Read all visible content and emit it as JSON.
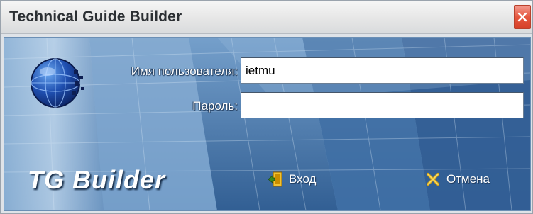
{
  "window": {
    "title": "Technical Guide Builder"
  },
  "form": {
    "username_label": "Имя пользователя:",
    "username_value": "ietmu",
    "password_label": "Пароль:",
    "password_value": ""
  },
  "branding": {
    "logo_text": "TG Builder"
  },
  "actions": {
    "login_label": "Вход",
    "cancel_label": "Отмена"
  },
  "icons": {
    "close": "close-icon",
    "globe": "globe-icon",
    "login": "door-enter-icon",
    "cancel": "cancel-x-icon"
  },
  "colors": {
    "background_blue": "#3f74ab",
    "close_red": "#e5573f",
    "cancel_gold": "#d9a514"
  }
}
